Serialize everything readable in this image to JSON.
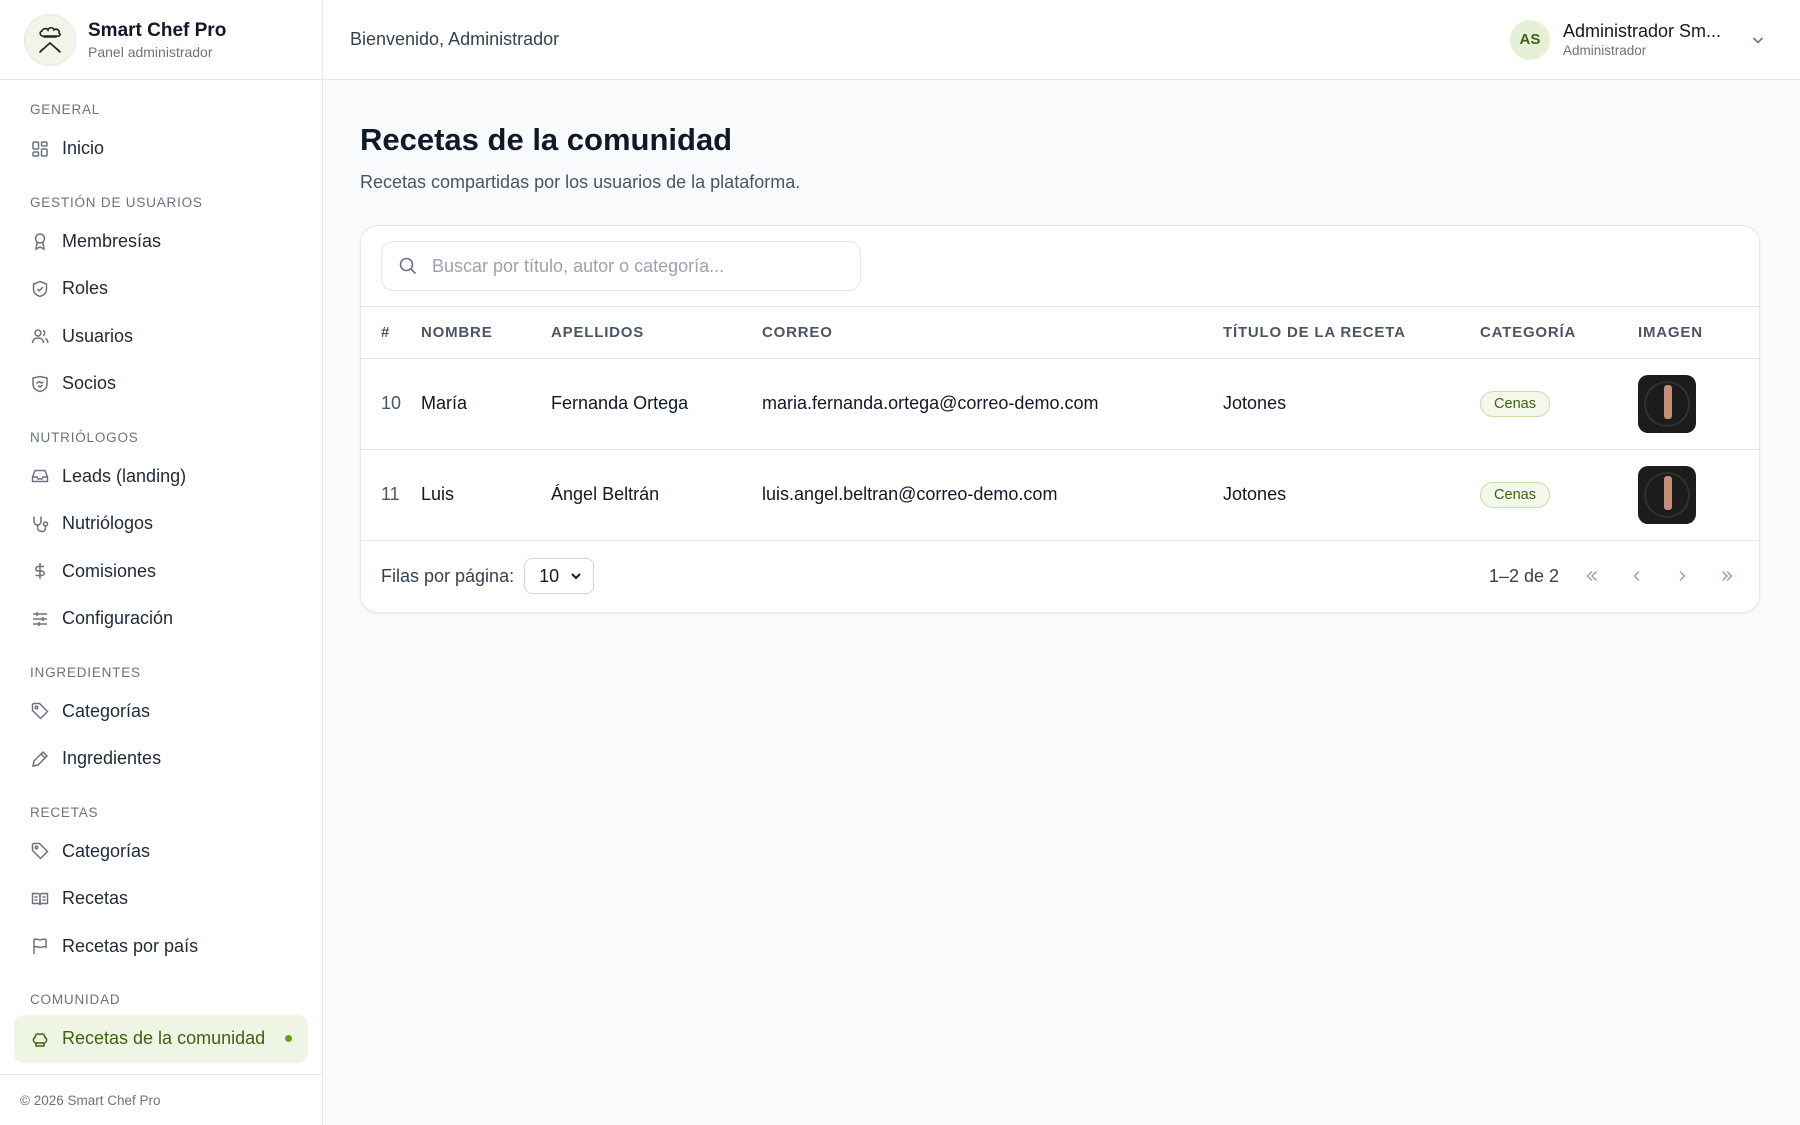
{
  "app": {
    "name": "Smart Chef Pro",
    "subtitle": "Panel administrador",
    "footer": "© 2026 Smart Chef Pro"
  },
  "header": {
    "welcome": "Bienvenido, Administrador",
    "user": {
      "initials": "AS",
      "name": "Administrador Sm...",
      "role": "Administrador"
    }
  },
  "sidebar": {
    "sections": [
      {
        "title": "General",
        "items": [
          {
            "label": "Inicio",
            "icon": "dashboard-icon"
          }
        ]
      },
      {
        "title": "Gestión de usuarios",
        "items": [
          {
            "label": "Membresías",
            "icon": "award-icon"
          },
          {
            "label": "Roles",
            "icon": "shield-icon"
          },
          {
            "label": "Usuarios",
            "icon": "users-icon"
          },
          {
            "label": "Socios",
            "icon": "handshake-icon"
          }
        ]
      },
      {
        "title": "Nutriólogos",
        "items": [
          {
            "label": "Leads (landing)",
            "icon": "inbox-icon"
          },
          {
            "label": "Nutriólogos",
            "icon": "stethoscope-icon"
          },
          {
            "label": "Comisiones",
            "icon": "dollar-icon"
          },
          {
            "label": "Configuración",
            "icon": "sliders-icon"
          }
        ]
      },
      {
        "title": "Ingredientes",
        "items": [
          {
            "label": "Categorías",
            "icon": "tag-icon"
          },
          {
            "label": "Ingredientes",
            "icon": "pen-icon"
          }
        ]
      },
      {
        "title": "Recetas",
        "items": [
          {
            "label": "Categorías",
            "icon": "tag-icon"
          },
          {
            "label": "Recetas",
            "icon": "book-icon"
          },
          {
            "label": "Recetas por país",
            "icon": "flag-icon"
          }
        ]
      },
      {
        "title": "Comunidad",
        "items": [
          {
            "label": "Recetas de la comunidad",
            "icon": "chef-hat-icon",
            "active": true
          }
        ]
      }
    ]
  },
  "main": {
    "title": "Recetas de la comunidad",
    "subtitle": "Recetas compartidas por los usuarios de la plataforma.",
    "search": {
      "placeholder": "Buscar por título, autor o categoría...",
      "value": ""
    },
    "table": {
      "columns": [
        "#",
        "Nombre",
        "Apellidos",
        "Correo",
        "Título de la receta",
        "Categoría",
        "Imagen"
      ],
      "rows": [
        {
          "id": "10",
          "nombre": "María",
          "apellidos": "Fernanda Ortega",
          "correo": "maria.fernanda.ortega@correo-demo.com",
          "titulo": "Jotones",
          "categoria": "Cenas"
        },
        {
          "id": "11",
          "nombre": "Luis",
          "apellidos": "Ángel Beltrán",
          "correo": "luis.angel.beltran@correo-demo.com",
          "titulo": "Jotones",
          "categoria": "Cenas"
        }
      ]
    },
    "pagination": {
      "rows_label": "Filas por página:",
      "rows_value": "10",
      "range": "1–2 de 2"
    }
  },
  "colors": {
    "accent": "#3f6212",
    "accent_bg": "#eef5e4",
    "badge_border": "#c9dcaa"
  }
}
